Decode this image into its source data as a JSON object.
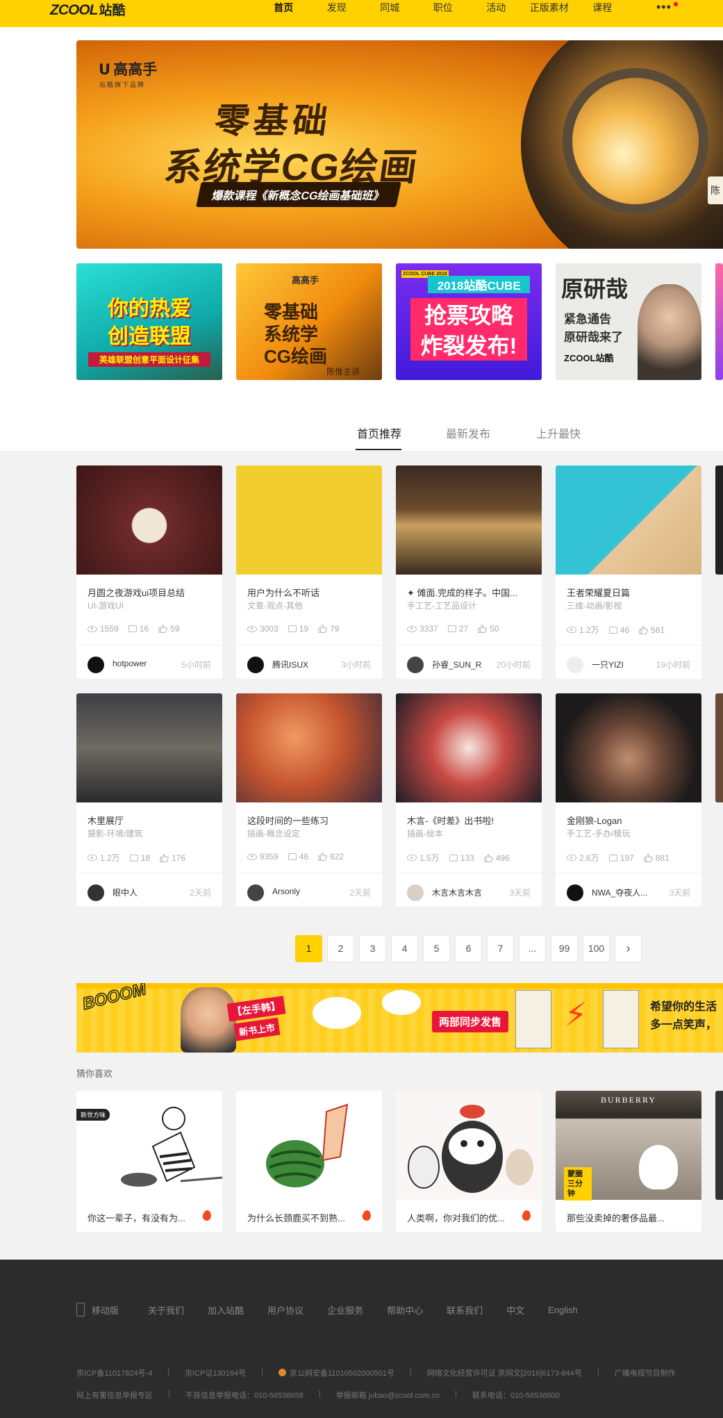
{
  "header": {
    "logo_en": "ZCOOL",
    "logo_cn": "站酷",
    "nav": [
      "首页",
      "发现",
      "同城",
      "职位",
      "活动",
      "正版素材",
      "课程"
    ],
    "more": "•••"
  },
  "hero": {
    "brand": "高高手",
    "brand_sub": "站酷旗下品牌",
    "line1": "零基础",
    "line2": "系统学CG绘画",
    "tagline": "爆款课程《新概念CG绘画基础班》",
    "side": "陈"
  },
  "promos": [
    {
      "line1": "你的热爱",
      "line2": "创造联盟",
      "line3": "英雄联盟创意平面设计征集"
    },
    {
      "brand": "高高手",
      "line1": "零基础",
      "line2": "系统学",
      "line3": "CG绘画",
      "author": "陈惟主讲"
    },
    {
      "tag": "ZCOOL CUBE 2018",
      "line1": "2018站酷CUBE",
      "line2": "抢票攻略",
      "line3": "炸裂发布!"
    },
    {
      "line1": "原研哉",
      "line2": "紧急通告",
      "line3": "原研哉来了",
      "line4": "ZCOOL站酷"
    }
  ],
  "tabs": [
    "首页推荐",
    "最新发布",
    "上升最快"
  ],
  "cards": [
    {
      "title": "月圆之夜游戏ui项目总结",
      "cat": "UI-游戏UI",
      "views": "1559",
      "comments": "16",
      "likes": "59",
      "author": "hotpower",
      "time": "5小时前"
    },
    {
      "title": "用户为什么不听话",
      "cat": "文章-观点-其他",
      "views": "3003",
      "comments": "19",
      "likes": "79",
      "author": "腾讯ISUX",
      "time": "3小时前"
    },
    {
      "title": "✦ 傩面.完成的样子。中国...",
      "cat": "手工艺-工艺品设计",
      "views": "3337",
      "comments": "27",
      "likes": "50",
      "author": "孙睿_SUN_R",
      "time": "20小时前"
    },
    {
      "title": "王者荣耀夏日篇",
      "cat": "三维-动画/影视",
      "views": "1.2万",
      "comments": "46",
      "likes": "561",
      "author": "一只YIZI",
      "time": "19小时前"
    },
    {
      "title": "木里展厅",
      "cat": "摄影-环境/建筑",
      "views": "1.2万",
      "comments": "18",
      "likes": "176",
      "author": "眼中人",
      "time": "2天前"
    },
    {
      "title": "这段时间的一些练习",
      "cat": "插画-概念设定",
      "views": "9359",
      "comments": "46",
      "likes": "622",
      "author": "Arsonly",
      "time": "2天前"
    },
    {
      "title": "木言-《时差》出书啦!",
      "cat": "插画-绘本",
      "views": "1.5万",
      "comments": "133",
      "likes": "496",
      "author": "木言木言木言",
      "time": "3天前"
    },
    {
      "title": "金刚狼-Logan",
      "cat": "手工艺-手办/模玩",
      "views": "2.6万",
      "comments": "197",
      "likes": "881",
      "author": "NWA_夺夜人...",
      "time": "3天前"
    }
  ],
  "pager": [
    "1",
    "2",
    "3",
    "4",
    "5",
    "6",
    "7",
    "...",
    "99",
    "100",
    "›"
  ],
  "banner": {
    "boom": "BOOOM",
    "tag1": "【左手韩】",
    "tag2": "新书上市",
    "sync": "两部同步发售",
    "hope1": "希望你的生活",
    "hope2": "多一点笑声，"
  },
  "guess": {
    "title": "猜你喜欢",
    "items": [
      {
        "title": "你这一辈子，有没有为...",
        "badge": "新世方味"
      },
      {
        "title": "为什么长颈鹿买不到熟..."
      },
      {
        "title": "人类啊，你对我们的优..."
      },
      {
        "title": "那些没卖掉的奢侈品最...",
        "brand": "BURBERRY",
        "tag": "蒙圈三分钟"
      }
    ]
  },
  "footer": {
    "links": [
      "移动版",
      "关于我们",
      "加入站酷",
      "用户协议",
      "企业服务",
      "帮助中心",
      "联系我们",
      "中文",
      "English"
    ],
    "line1": [
      "京ICP备11017824号-4",
      "京ICP证130164号",
      "京公网安备11010502000501号",
      "网络文化经营许可证 京网文[2016]6173-844号",
      "广播电视节目制作"
    ],
    "line2": [
      "网上有害信息举报专区",
      "不良信息举报电话：010-56538658",
      "举报邮箱 jubao@zcool.com.cn",
      "联系电话：010-56538600"
    ]
  },
  "colors": {
    "brand_yellow": "#ffd100",
    "footer_bg": "#2c2c2c"
  }
}
